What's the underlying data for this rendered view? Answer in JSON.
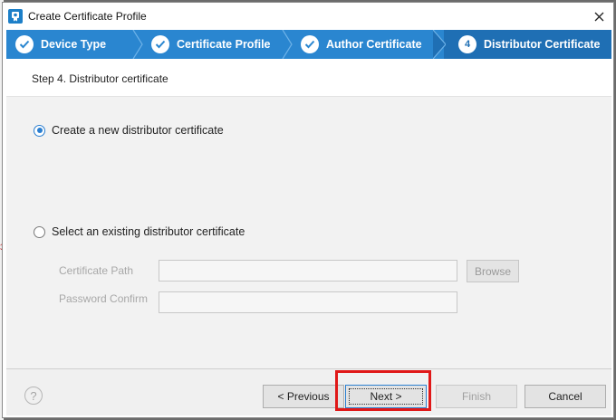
{
  "window": {
    "title": "Create Certificate Profile"
  },
  "steps": [
    {
      "label": "Device Type",
      "state": "done"
    },
    {
      "label": "Certificate Profile",
      "state": "done"
    },
    {
      "label": "Author Certificate",
      "state": "done"
    },
    {
      "label": "Distributor Certificate",
      "state": "active",
      "number": "4"
    }
  ],
  "step_heading": "Step 4. Distributor certificate",
  "options": {
    "create_new": {
      "label": "Create a new distributor certificate",
      "selected": true
    },
    "select_existing": {
      "label": "Select an existing distributor certificate",
      "selected": false
    }
  },
  "fields": {
    "certificate_path": {
      "label": "Certificate Path",
      "value": ""
    },
    "password_confirm": {
      "label": "Password Confirm",
      "value": ""
    }
  },
  "buttons": {
    "browse": "Browse",
    "previous": "< Previous",
    "next": "Next >",
    "finish": "Finish",
    "cancel": "Cancel",
    "help": "?"
  },
  "colors": {
    "stepbar": "#2a86d0",
    "stepbar_active": "#1f6fb4",
    "highlight": "#e01818"
  }
}
